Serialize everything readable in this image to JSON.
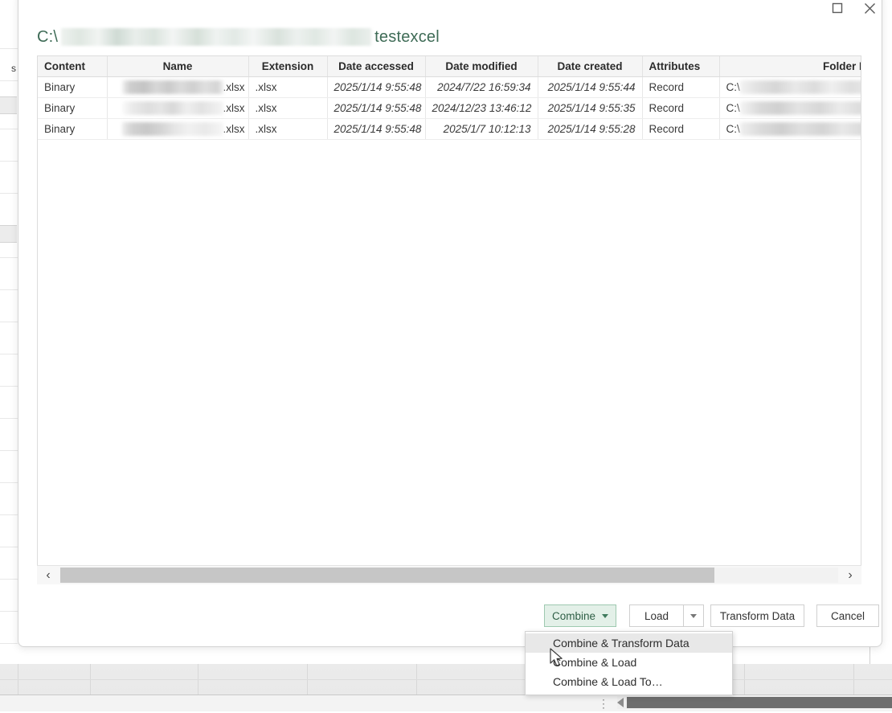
{
  "background_app": {
    "left_row_label": "s",
    "name": "excel-worksheet"
  },
  "dialog": {
    "titlebar": {
      "maximize_label": "Maximize",
      "close_label": "Close"
    },
    "path": {
      "prefix": "C:\\",
      "redacted": "",
      "folder": "testexcel"
    },
    "table": {
      "columns": [
        {
          "key": "content",
          "label": "Content"
        },
        {
          "key": "name",
          "label": "Name"
        },
        {
          "key": "extension",
          "label": "Extension"
        },
        {
          "key": "accessed",
          "label": "Date accessed"
        },
        {
          "key": "modified",
          "label": "Date modified"
        },
        {
          "key": "created",
          "label": "Date created"
        },
        {
          "key": "attributes",
          "label": "Attributes"
        },
        {
          "key": "folder",
          "label": "Folder Pa"
        }
      ],
      "rows": [
        {
          "content": "Binary",
          "name_ext": ".xlsx",
          "extension": ".xlsx",
          "accessed": "2025/1/14 9:55:48",
          "modified": "2024/7/22 16:59:34",
          "created": "2025/1/14 9:55:44",
          "attributes": "Record",
          "folder_prefix": "C:\\"
        },
        {
          "content": "Binary",
          "name_ext": ".xlsx",
          "extension": ".xlsx",
          "accessed": "2025/1/14 9:55:48",
          "modified": "2024/12/23 13:46:12",
          "created": "2025/1/14 9:55:35",
          "attributes": "Record",
          "folder_prefix": "C:\\"
        },
        {
          "content": "Binary",
          "name_ext": ".xlsx",
          "extension": ".xlsx",
          "accessed": "2025/1/14 9:55:48",
          "modified": "2025/1/7 10:12:13",
          "created": "2025/1/14 9:55:28",
          "attributes": "Record",
          "folder_prefix": "C:\\"
        }
      ]
    },
    "scrollbar": {
      "left_arrow": "‹",
      "right_arrow": "›"
    },
    "footer": {
      "combine_label": "Combine",
      "load_label": "Load",
      "transform_label": "Transform Data",
      "cancel_label": "Cancel"
    },
    "combine_menu": {
      "items": [
        {
          "label": "Combine & Transform Data",
          "highlighted": true
        },
        {
          "label": "Combine & Load",
          "highlighted": false
        },
        {
          "label": "Combine & Load To…",
          "highlighted": false
        }
      ]
    }
  },
  "colors": {
    "accent_green": "#3e6b56",
    "combine_fill": "#e3f0e8",
    "combine_border": "#9ec9b0",
    "menu_highlight": "#e8e8e8"
  }
}
